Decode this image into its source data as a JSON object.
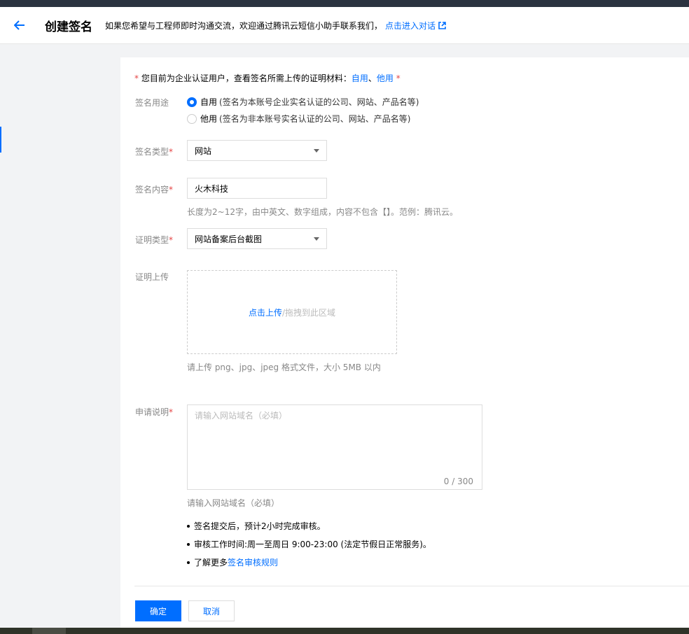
{
  "header": {
    "title": "创建签名",
    "tip": "如果您希望与工程师即时沟通交流，欢迎通过腾讯云短信小助手联系我们，",
    "tip_link": "点击进入对话"
  },
  "notice": {
    "asterisk": "*",
    "text": " 您目前为企业认证用户，查看签名所需上传的证明材料：",
    "link_self": "自用",
    "separator": "、",
    "link_other": "他用",
    "trailing": " *"
  },
  "form": {
    "required_mark": "*",
    "usage": {
      "label": "签名用途",
      "options": [
        {
          "label": "自用",
          "hint": "(签名为本账号企业实名认证的公司、网站、产品名等)",
          "checked": true
        },
        {
          "label": "他用",
          "hint": "(签名为非本账号实名认证的公司、网站、产品名等)",
          "checked": false
        }
      ]
    },
    "type": {
      "label": "签名类型",
      "value": "网站"
    },
    "content": {
      "label": "签名内容",
      "value": "火木科技",
      "help": "长度为2~12字，由中英文、数字组成，内容不包含【】。范例：腾讯云。"
    },
    "proof_type": {
      "label": "证明类型",
      "value": "网站备案后台截图"
    },
    "proof_upload": {
      "label": "证明上传",
      "link": "点击上传",
      "rest": "/拖拽到此区域",
      "help": "请上传 png、jpg、jpeg 格式文件，大小 5MB 以内"
    },
    "description": {
      "label": "申请说明",
      "placeholder": "请输入网站域名（必填）",
      "counter": "0 / 300",
      "help": "请输入网站域名（必填）"
    }
  },
  "bullets": {
    "b1": "签名提交后，预计2小时完成审核。",
    "b2": "审核工作时间:周一至周日 9:00-23:00 (法定节假日正常服务)。",
    "b3_prefix": "了解更多",
    "b3_link": "签名审核规则"
  },
  "actions": {
    "confirm": "确定",
    "cancel": "取消"
  },
  "colors": {
    "primary": "#006eff",
    "required": "#e54545",
    "topbar": "#2b3340"
  }
}
